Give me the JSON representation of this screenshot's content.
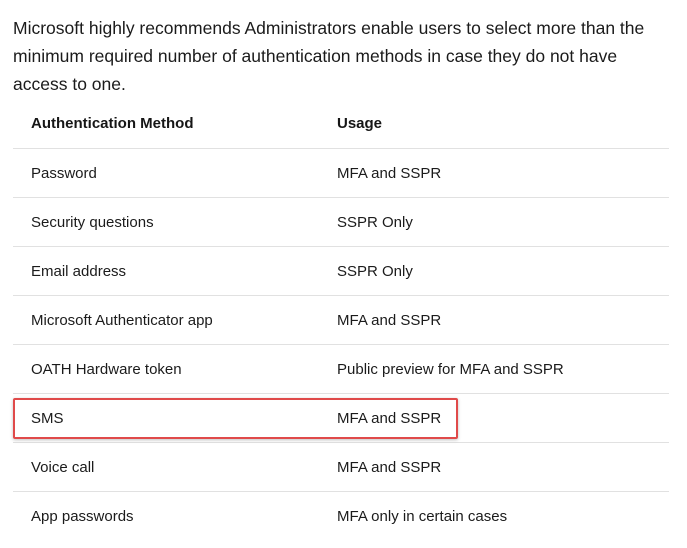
{
  "intro_text": "Microsoft highly recommends Administrators enable users to select more than the minimum required number of authentication methods in case they do not have access to one.",
  "table": {
    "headers": [
      "Authentication Method",
      "Usage"
    ],
    "rows": [
      [
        "Password",
        "MFA and SSPR"
      ],
      [
        "Security questions",
        "SSPR Only"
      ],
      [
        "Email address",
        "SSPR Only"
      ],
      [
        "Microsoft Authenticator app",
        "MFA and SSPR"
      ],
      [
        "OATH Hardware token",
        "Public preview for MFA and SSPR"
      ],
      [
        "SMS",
        "MFA and SSPR"
      ],
      [
        "Voice call",
        "MFA and SSPR"
      ],
      [
        "App passwords",
        "MFA only in certain cases"
      ]
    ]
  },
  "highlight_color": "#e04a4a"
}
